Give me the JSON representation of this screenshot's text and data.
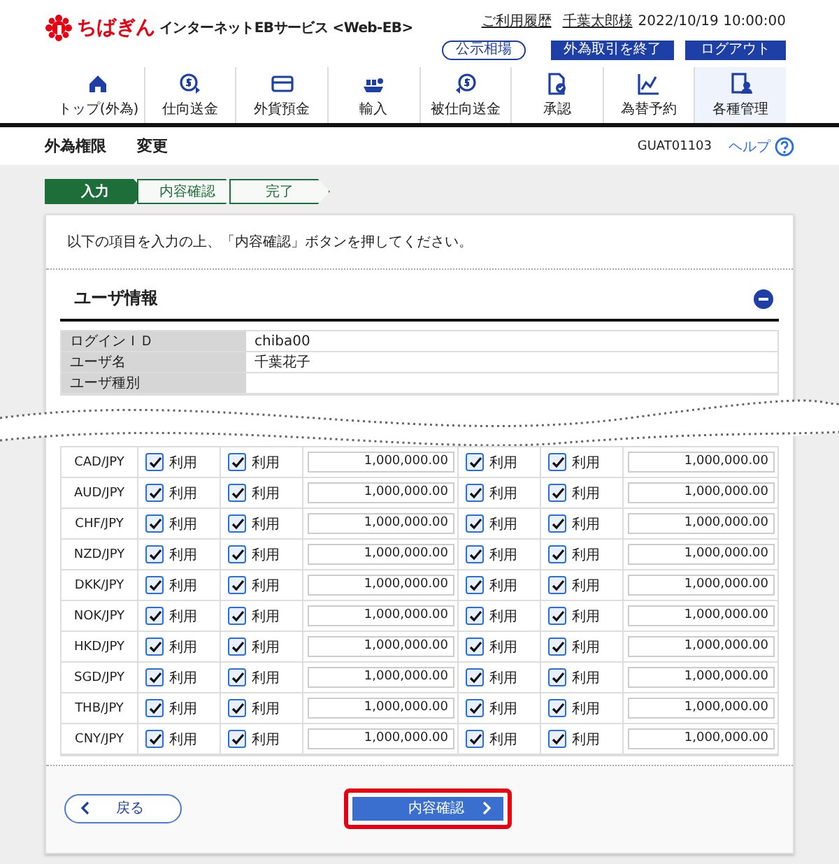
{
  "header": {
    "logo": "ちばぎん",
    "service": "インターネットEBサービス <Web-EB>",
    "links": [
      "ご利用履歴",
      "千葉太郎様"
    ],
    "datetime": "2022/10/19 10:00:00",
    "buttons": [
      {
        "label": "公示相場",
        "kind": "outline"
      },
      {
        "label": "外為取引を終了",
        "kind": "solid"
      },
      {
        "label": "ログアウト",
        "kind": "solid"
      }
    ]
  },
  "nav": [
    {
      "label": "トップ(外為)",
      "selected": false
    },
    {
      "label": "仕向送金",
      "selected": false
    },
    {
      "label": "外貨預金",
      "selected": false
    },
    {
      "label": "輸入",
      "selected": false
    },
    {
      "label": "被仕向送金",
      "selected": false
    },
    {
      "label": "承認",
      "selected": false
    },
    {
      "label": "為替予約",
      "selected": false
    },
    {
      "label": "各種管理",
      "selected": true
    }
  ],
  "page": {
    "title": "外為権限",
    "subtitle": "変更",
    "code": "GUAT01103",
    "help": "ヘルプ"
  },
  "steps": [
    {
      "label": "入力",
      "selected": true
    },
    {
      "label": "内容確認",
      "selected": false
    },
    {
      "label": "完了",
      "selected": false
    }
  ],
  "instruction": "以下の項目を入力の上、「内容確認」ボタンを押してください。",
  "section": {
    "title": "ユーザ情報",
    "expanded": true
  },
  "user_info": [
    {
      "label": "ログインＩＤ",
      "value": "chiba00"
    },
    {
      "label": "ユーザ名",
      "value": "千葉花子"
    },
    {
      "label": "ユーザ種別"
    }
  ],
  "currencies": [
    {
      "pair": "CAD/JPY",
      "cells": [
        {
          "kind": "check",
          "label": "利用",
          "checked": true
        },
        {
          "kind": "check",
          "label": "利用",
          "checked": true
        },
        {
          "kind": "amount",
          "value": "1,000,000.00"
        },
        {
          "kind": "check",
          "label": "利用",
          "checked": true
        },
        {
          "kind": "check",
          "label": "利用",
          "checked": true
        },
        {
          "kind": "amount",
          "value": "1,000,000.00"
        }
      ]
    },
    {
      "pair": "AUD/JPY",
      "cells": [
        {
          "kind": "check",
          "label": "利用",
          "checked": true
        },
        {
          "kind": "check",
          "label": "利用",
          "checked": true
        },
        {
          "kind": "amount",
          "value": "1,000,000.00"
        },
        {
          "kind": "check",
          "label": "利用",
          "checked": true
        },
        {
          "kind": "check",
          "label": "利用",
          "checked": true
        },
        {
          "kind": "amount",
          "value": "1,000,000.00"
        }
      ]
    },
    {
      "pair": "CHF/JPY",
      "cells": [
        {
          "kind": "check",
          "label": "利用",
          "checked": true
        },
        {
          "kind": "check",
          "label": "利用",
          "checked": true
        },
        {
          "kind": "amount",
          "value": "1,000,000.00"
        },
        {
          "kind": "check",
          "label": "利用",
          "checked": true
        },
        {
          "kind": "check",
          "label": "利用",
          "checked": true
        },
        {
          "kind": "amount",
          "value": "1,000,000.00"
        }
      ]
    },
    {
      "pair": "NZD/JPY",
      "cells": [
        {
          "kind": "check",
          "label": "利用",
          "checked": true
        },
        {
          "kind": "check",
          "label": "利用",
          "checked": true
        },
        {
          "kind": "amount",
          "value": "1,000,000.00"
        },
        {
          "kind": "check",
          "label": "利用",
          "checked": true
        },
        {
          "kind": "check",
          "label": "利用",
          "checked": true
        },
        {
          "kind": "amount",
          "value": "1,000,000.00"
        }
      ]
    },
    {
      "pair": "DKK/JPY",
      "cells": [
        {
          "kind": "check",
          "label": "利用",
          "checked": true
        },
        {
          "kind": "check",
          "label": "利用",
          "checked": true
        },
        {
          "kind": "amount",
          "value": "1,000,000.00"
        },
        {
          "kind": "check",
          "label": "利用",
          "checked": true
        },
        {
          "kind": "check",
          "label": "利用",
          "checked": true
        },
        {
          "kind": "amount",
          "value": "1,000,000.00"
        }
      ]
    },
    {
      "pair": "NOK/JPY",
      "cells": [
        {
          "kind": "check",
          "label": "利用",
          "checked": true
        },
        {
          "kind": "check",
          "label": "利用",
          "checked": true
        },
        {
          "kind": "amount",
          "value": "1,000,000.00"
        },
        {
          "kind": "check",
          "label": "利用",
          "checked": true
        },
        {
          "kind": "check",
          "label": "利用",
          "checked": true
        },
        {
          "kind": "amount",
          "value": "1,000,000.00"
        }
      ]
    },
    {
      "pair": "HKD/JPY",
      "cells": [
        {
          "kind": "check",
          "label": "利用",
          "checked": true
        },
        {
          "kind": "check",
          "label": "利用",
          "checked": true
        },
        {
          "kind": "amount",
          "value": "1,000,000.00"
        },
        {
          "kind": "check",
          "label": "利用",
          "checked": true
        },
        {
          "kind": "check",
          "label": "利用",
          "checked": true
        },
        {
          "kind": "amount",
          "value": "1,000,000.00"
        }
      ]
    },
    {
      "pair": "SGD/JPY",
      "cells": [
        {
          "kind": "check",
          "label": "利用",
          "checked": true
        },
        {
          "kind": "check",
          "label": "利用",
          "checked": true
        },
        {
          "kind": "amount",
          "value": "1,000,000.00"
        },
        {
          "kind": "check",
          "label": "利用",
          "checked": true
        },
        {
          "kind": "check",
          "label": "利用",
          "checked": true
        },
        {
          "kind": "amount",
          "value": "1,000,000.00"
        }
      ]
    },
    {
      "pair": "THB/JPY",
      "cells": [
        {
          "kind": "check",
          "label": "利用",
          "checked": true
        },
        {
          "kind": "check",
          "label": "利用",
          "checked": true
        },
        {
          "kind": "amount",
          "value": "1,000,000.00"
        },
        {
          "kind": "check",
          "label": "利用",
          "checked": true
        },
        {
          "kind": "check",
          "label": "利用",
          "checked": true
        },
        {
          "kind": "amount",
          "value": "1,000,000.00"
        }
      ]
    },
    {
      "pair": "CNY/JPY",
      "cells": [
        {
          "kind": "check",
          "label": "利用",
          "checked": true
        },
        {
          "kind": "check",
          "label": "利用",
          "checked": true
        },
        {
          "kind": "amount",
          "value": "1,000,000.00"
        },
        {
          "kind": "check",
          "label": "利用",
          "checked": true
        },
        {
          "kind": "check",
          "label": "利用",
          "checked": true
        },
        {
          "kind": "amount",
          "value": "1,000,000.00"
        }
      ]
    }
  ],
  "footer": {
    "back": "戻る",
    "confirm": {
      "label": "内容確認",
      "highlighted": true
    }
  }
}
